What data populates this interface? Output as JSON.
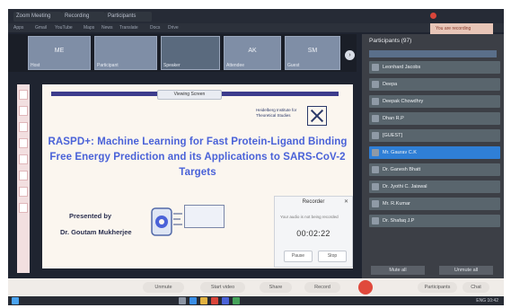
{
  "browser": {
    "tabs": [
      "Zoom Meeting",
      "Recording",
      "Participants"
    ],
    "bookmarks": [
      "Apps",
      "Gmail",
      "YouTube",
      "Maps",
      "News",
      "Translate",
      "Docs",
      "Drive"
    ]
  },
  "video_strip": {
    "tiles": [
      {
        "name": "Host",
        "initials": "ME"
      },
      {
        "name": "Participant",
        "initials": ""
      },
      {
        "name": "Speaker",
        "initials": ""
      },
      {
        "name": "Attendee",
        "initials": "AK"
      },
      {
        "name": "Guest",
        "initials": "SM"
      }
    ]
  },
  "share_banner": "Viewing Screen",
  "slide": {
    "institute": "Heidelberg Institute for Theoretical Studies",
    "title": "RASPD+: Machine Learning for Fast Protein-Ligand Binding Free Energy Prediction and its Applications to SARS-CoV-2 Targets",
    "presented_by": "Presented by",
    "author": "Dr. Goutam Mukherjee"
  },
  "recorder": {
    "title": "Recorder",
    "message": "Your audio is not being recorded",
    "time": "00:02:22",
    "pause_label": "Pause",
    "stop_label": "Stop"
  },
  "participants": {
    "title": "Participants (97)",
    "banner": "You are recording",
    "list": [
      "Leonhard Jacobs",
      "Deepa",
      "Deepak Chowdhry",
      "Dhan R.P",
      "[GUEST]",
      "Mr. Gaurav C.K",
      "Dr. Ganesh Bhatt",
      "Dr. Jyothi C. Jaiswal",
      "Mr. R.Kumar",
      "Dr. Shafaq J.P"
    ],
    "selected_index": 5,
    "mute_all": "Mute all",
    "unmute_all": "Unmute all"
  },
  "toolbar": {
    "unmute": "Unmute",
    "start_video": "Start video",
    "share": "Share",
    "record": "Record",
    "participants": "Participants",
    "chat": "Chat"
  },
  "taskbar": {
    "clock": "ENG 10:42"
  },
  "colors": {
    "accent": "#2f7fd6",
    "title_blue": "#4a62d8",
    "leave_red": "#e0493c"
  }
}
